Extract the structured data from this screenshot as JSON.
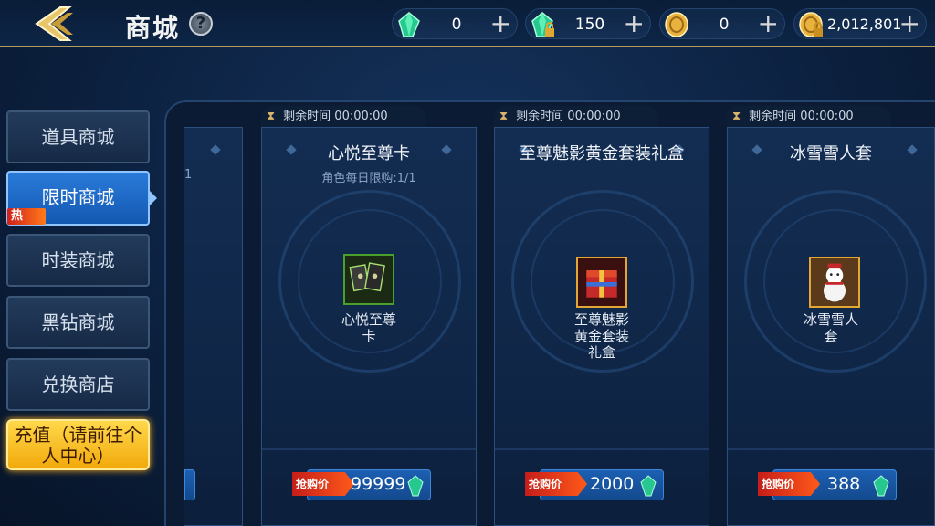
{
  "header": {
    "title": "商城",
    "help_label": "?"
  },
  "currencies": [
    {
      "icon": "green-diamond-icon",
      "value": "0"
    },
    {
      "icon": "locked-green-diamond-icon",
      "value": "150"
    },
    {
      "icon": "gold-coin-icon",
      "value": "0"
    },
    {
      "icon": "locked-gold-coin-icon",
      "value": "2,012,801"
    }
  ],
  "sidebar": {
    "items": [
      {
        "label": "道具商城"
      },
      {
        "label": "限时商城",
        "badge": "热"
      },
      {
        "label": "时装商城"
      },
      {
        "label": "黑钻商城"
      },
      {
        "label": "兑换商店"
      }
    ],
    "recharge_label": "充值（请前往个人中心）"
  },
  "partial_card": {
    "fragment": "1"
  },
  "cards": [
    {
      "timer_label": "剩余时间",
      "timer": "00:00:00",
      "title": "心悦至尊卡",
      "limit": "角色每日限购:1/1",
      "item_name_line1": "心悦至尊",
      "item_name_line2": "卡",
      "item_name_line3": "",
      "price_tag": "抢购价",
      "price": "99999"
    },
    {
      "timer_label": "剩余时间",
      "timer": "00:00:00",
      "title": "至尊魅影黄金套装礼盒",
      "limit": "",
      "item_name_line1": "至尊魅影",
      "item_name_line2": "黄金套装",
      "item_name_line3": "礼盒",
      "price_tag": "抢购价",
      "price": "2000"
    },
    {
      "timer_label": "剩余时间",
      "timer": "00:00:00",
      "title": "冰雪雪人套",
      "limit": "",
      "item_name_line1": "冰雪雪人",
      "item_name_line2": "套",
      "item_name_line3": "",
      "price_tag": "抢购价",
      "price": "388"
    }
  ],
  "colors": {
    "accent_gold": "#b89a5a",
    "active_tab": "#1f6dcc",
    "price_box": "#1c5fb2",
    "recharge": "#f2a90c"
  }
}
